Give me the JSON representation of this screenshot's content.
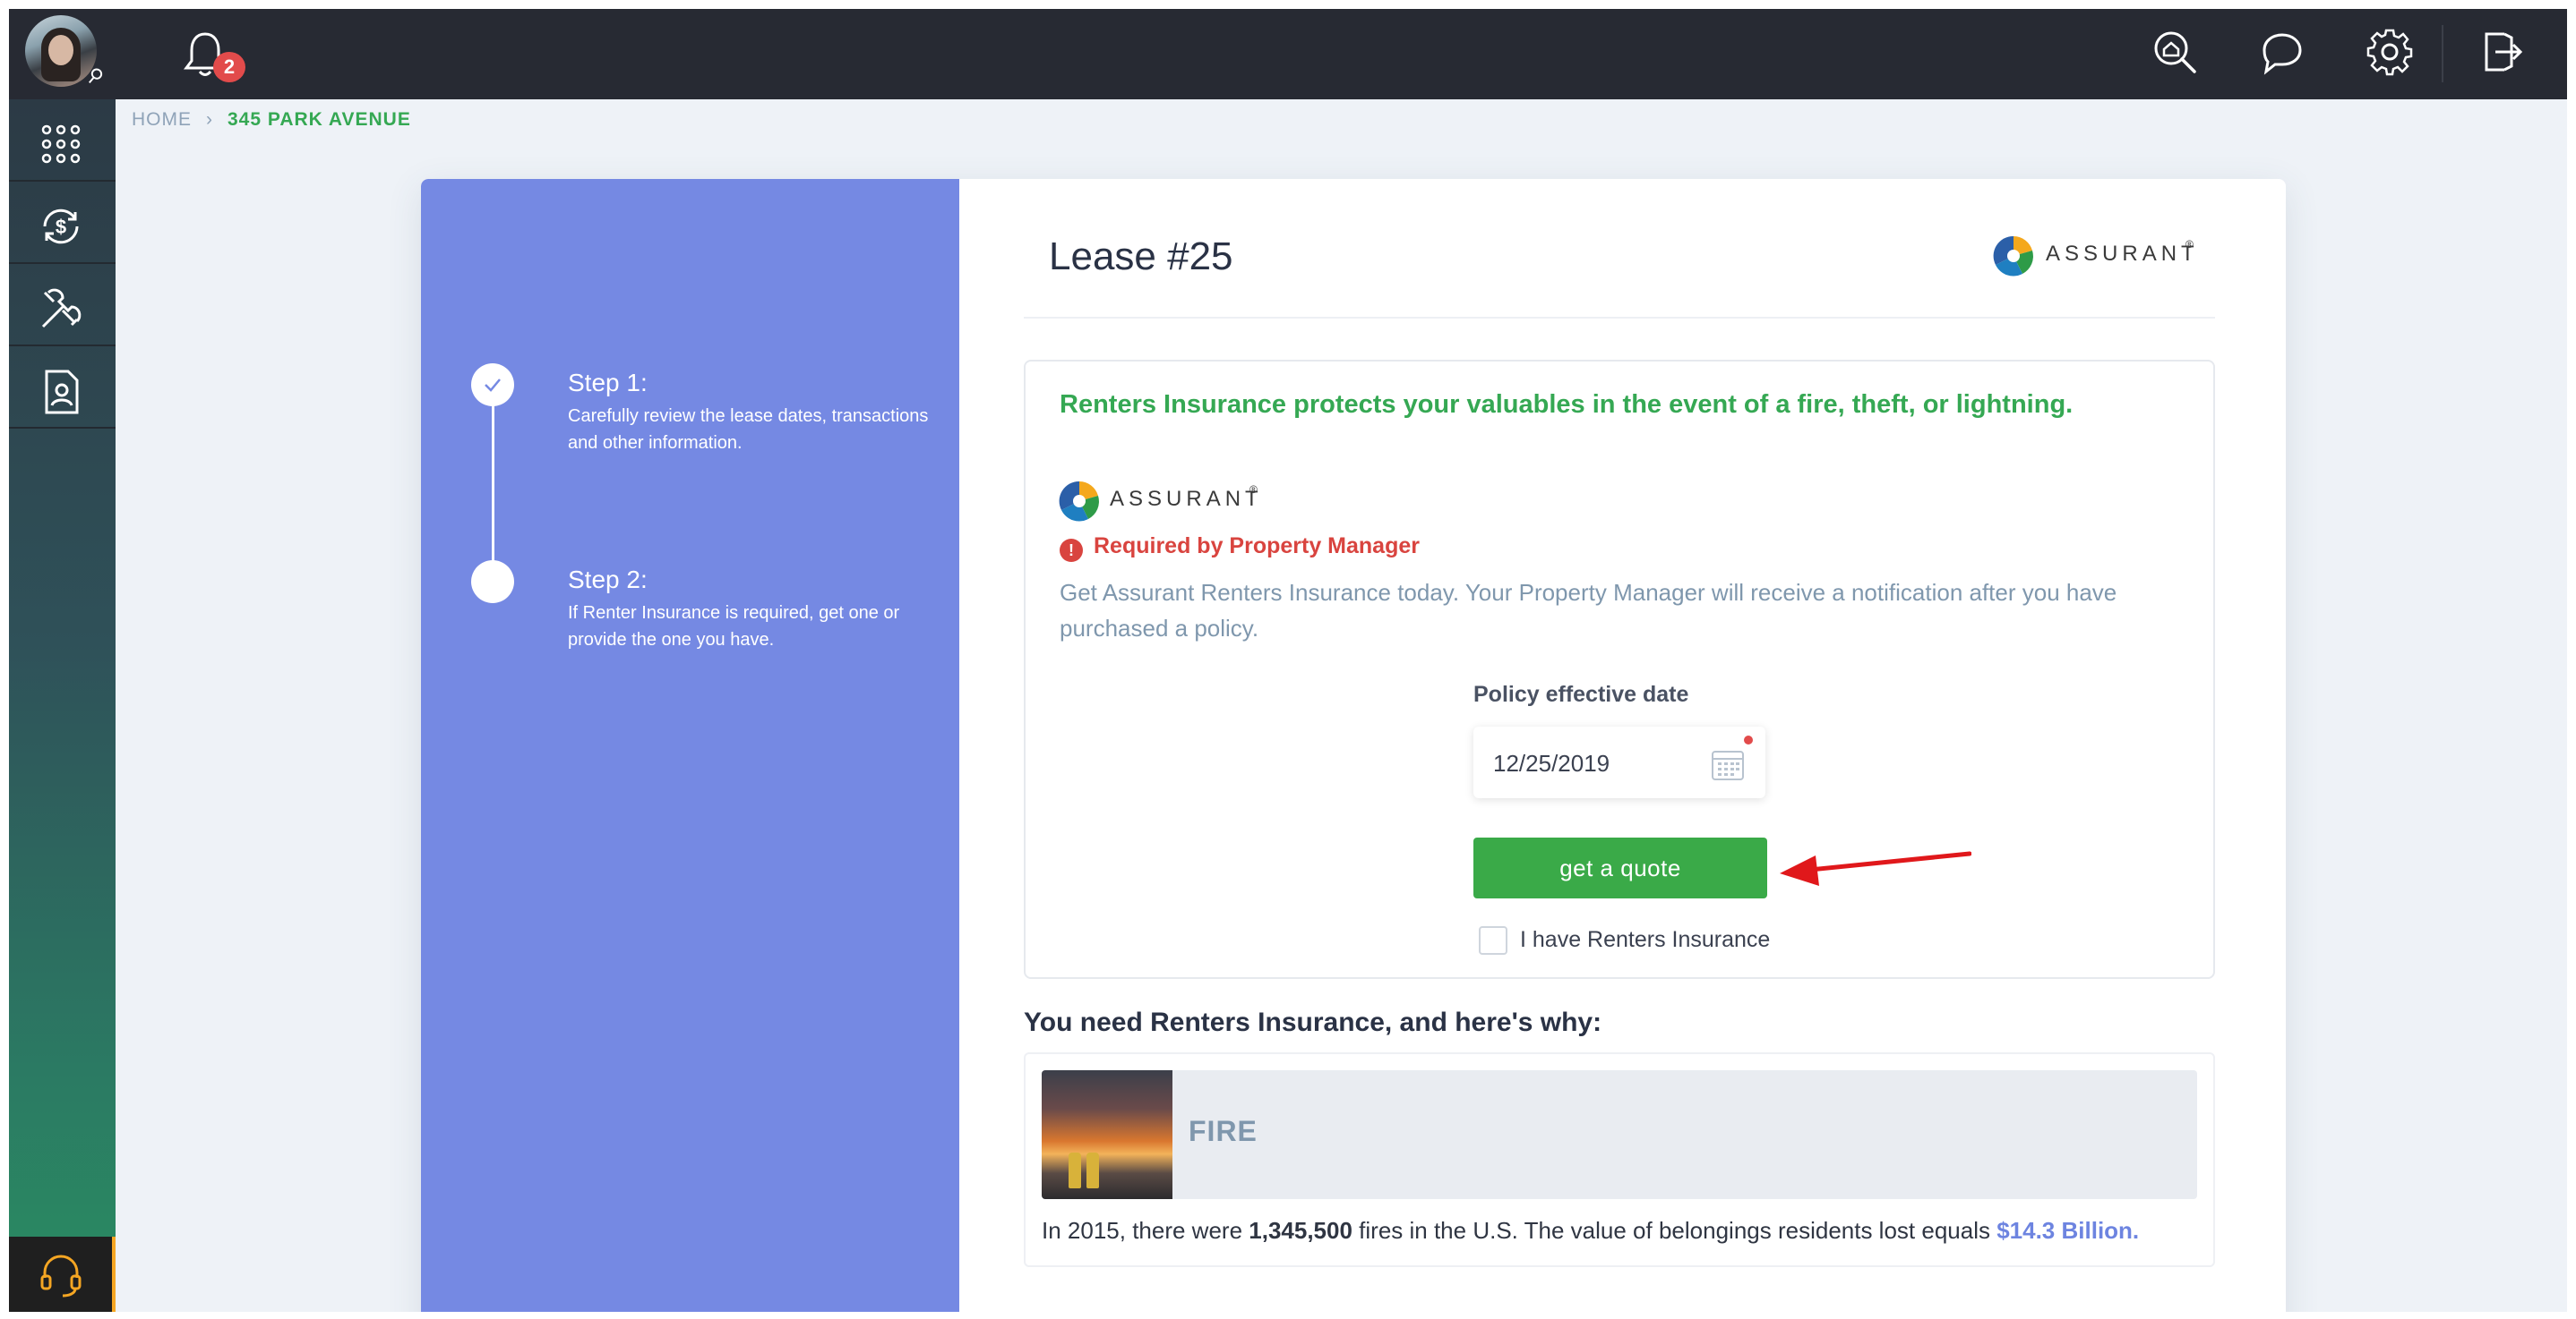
{
  "topbar": {
    "notifications_count": "2",
    "icons": [
      "home-search-icon",
      "chat-icon",
      "gear-icon",
      "logout-icon"
    ]
  },
  "sidebar": {
    "items": [
      "apps-grid-icon",
      "payments-icon",
      "maintenance-icon",
      "documents-icon"
    ],
    "support_icon": "headset-icon"
  },
  "breadcrumb": {
    "home": "HOME",
    "current": "345 PARK AVENUE"
  },
  "steps": [
    {
      "title": "Step 1:",
      "desc": "Carefully review the lease dates, transactions and other information.",
      "done": true
    },
    {
      "title": "Step 2:",
      "desc": "If Renter Insurance is required, get one or provide the one you have.",
      "done": false
    }
  ],
  "lease": {
    "title": "Lease #25",
    "brand": "ASSURANT",
    "brand_mark": "®"
  },
  "insurance": {
    "headline": "Renters Insurance protects your valuables in the event of a fire, theft, or lightning.",
    "brand": "ASSURANT",
    "brand_mark": "®",
    "required_label": "Required by Property Manager",
    "description": "Get Assurant Renters Insurance today. Your Property Manager will receive a notification after you have purchased a policy.",
    "date_label": "Policy effective date",
    "date_value": "12/25/2019",
    "quote_button": "get a quote",
    "have_insurance_label": "I have Renters Insurance",
    "have_insurance_checked": false
  },
  "why": {
    "title": "You need Renters Insurance, and here's why:",
    "items": [
      {
        "label": "FIRE",
        "text_prefix": "In 2015, there were ",
        "count": "1,345,500",
        "text_middle": " fires in the U.S. The value of belongings residents lost equals ",
        "amount": "$14.3 Billion."
      }
    ]
  },
  "colors": {
    "accent_green": "#3aaa48",
    "steps_panel": "#7589e3",
    "alert_red": "#d9443f",
    "topbar": "#272a33"
  }
}
